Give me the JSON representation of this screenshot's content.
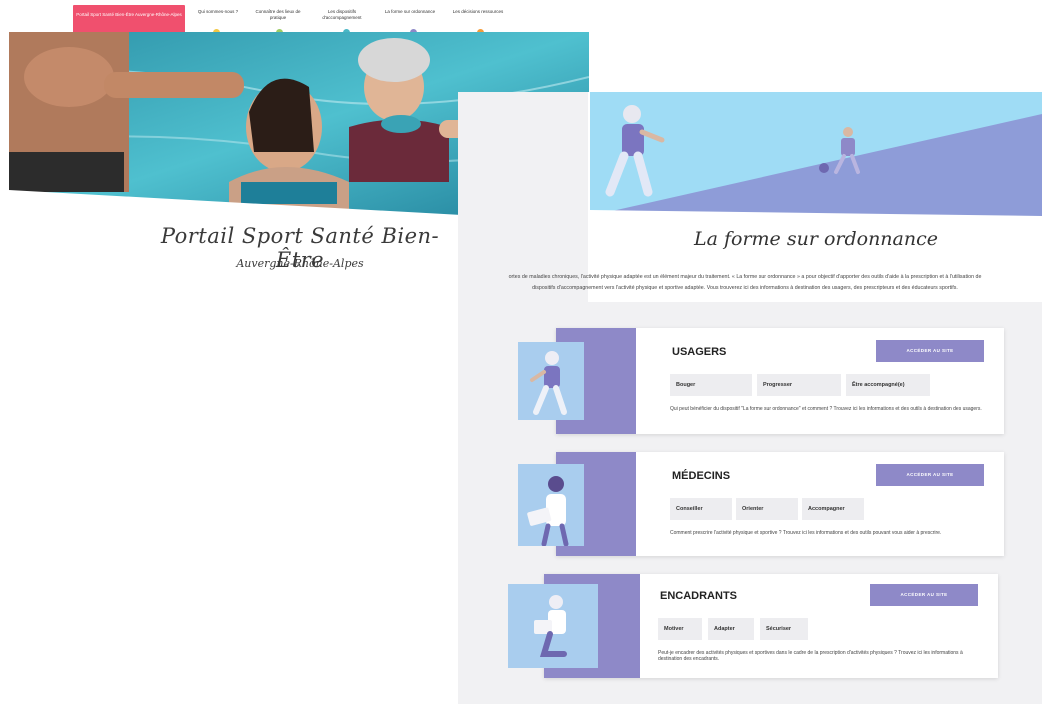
{
  "nav": {
    "brand": "Portail Sport Santé Bien-Être Auvergne-Rhône-Alpes",
    "items": [
      {
        "label": "Qui sommes-nous ?",
        "color": "#f0506e"
      },
      {
        "label": "Connaître des lieux de pratique",
        "color": "#f2c744"
      },
      {
        "label": "Les dispositifs d'accompagnement",
        "color": "#9ccc65"
      },
      {
        "label": "La forme sur ordonnance",
        "color": "#4ab7c5"
      },
      {
        "label": "Les décisions ressources",
        "color": "#8e89c8"
      }
    ]
  },
  "portal": {
    "title": "Portail Sport Santé Bien-Être",
    "subtitle": "Auvergne-Rhône-Alpes"
  },
  "ordonnance": {
    "title": "La forme sur ordonnance",
    "intro": "ortes de maladies chroniques, l'activité physique adaptée est un élément majeur du traitement. « La forme sur ordonnance » a pour objectif d'apporter des outils d'aide à la prescription et à l'utilisation de dispositifs d'accompagnement vers l'activité physique et sportive adaptée. Vous trouverez ici des informations à destination des usagers, des prescripteurs et des éducateurs sportifs."
  },
  "cards": [
    {
      "heading": "USAGERS",
      "cta": "ACCÉDER AU SITE",
      "tags": [
        "Bouger",
        "Progresser",
        "Être accompagné(e)"
      ],
      "description": "Qui peut bénéficier du dispositif \"La forme sur ordonnance\" et comment ? Trouvez ici les informations et des outils à destination des usagers."
    },
    {
      "heading": "MÉDECINS",
      "cta": "ACCÉDER AU SITE",
      "tags": [
        "Conseiller",
        "Orienter",
        "Accompagner"
      ],
      "description": "Comment prescrire l'activité physique et sportive ? Trouvez ici les informations et des outils pouvant vous aider à prescrire."
    },
    {
      "heading": "ENCADRANTS",
      "cta": "ACCÉDER AU SITE",
      "tags": [
        "Motiver",
        "Adapter",
        "Sécuriser"
      ],
      "description": "Peut-je encadrer des activités physiques et sportives dans le cadre de la prescription d'activités physiques ? Trouvez ici les informations à destination des encadrants."
    }
  ],
  "colors": {
    "accent": "#8e89c8",
    "brand": "#f0506e",
    "illustration": "#a9cdee"
  }
}
